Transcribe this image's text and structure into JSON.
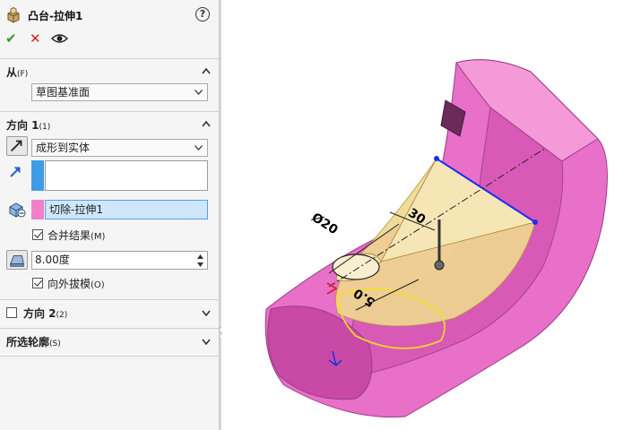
{
  "feature": {
    "title": "凸台-拉伸1",
    "help_icon": "?"
  },
  "actions": {
    "ok_icon": "✔",
    "cancel_icon": "✕",
    "preview_icon": "eye-icon"
  },
  "from_section": {
    "title": "从",
    "shortcut": "(F)",
    "start_condition": "草图基准面"
  },
  "direction1": {
    "title": "方向 1",
    "shortcut": "(1)",
    "end_condition": "成形到实体",
    "target_body": "切除-拉伸1",
    "merge_label": "合并结果",
    "merge_shortcut": "(M)",
    "merge_checked": true,
    "draft_angle": "8.00度",
    "draft_outward_label": "向外拔模",
    "draft_outward_shortcut": "(O)",
    "draft_outward_checked": true
  },
  "direction2": {
    "title": "方向 2",
    "shortcut": "(2)",
    "checked": false
  },
  "selected_contours": {
    "title": "所选轮廓",
    "shortcut": "(S)"
  },
  "viewport": {
    "dim_diameter": "Ø20",
    "dim_angle": "30",
    "dim_distance": "5.0"
  },
  "colors": {
    "part_pink": "#e870c8",
    "preview_yellow": "#f0d890",
    "selected_line_blue": "#1a2ef0",
    "sketch_yellow": "#f2e020",
    "swatch_blue": "#3f9ae8",
    "swatch_pink": "#f080c8"
  }
}
